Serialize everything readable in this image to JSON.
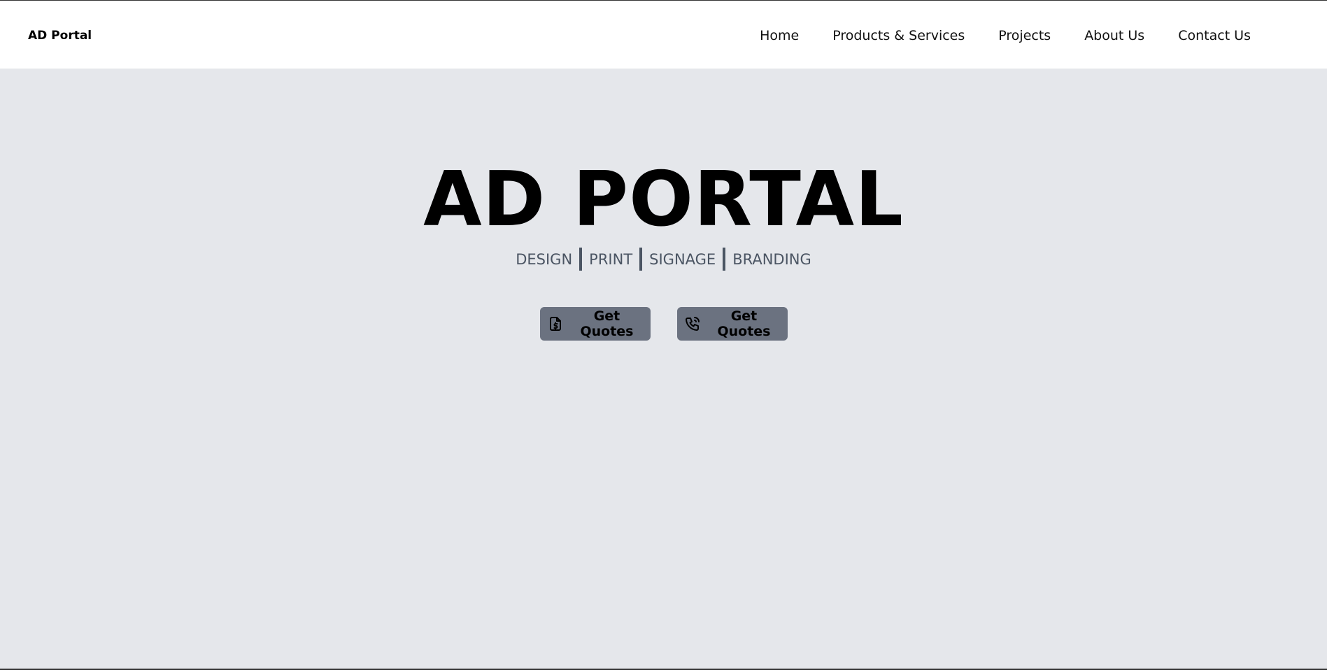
{
  "navbar": {
    "brand": "AD Portal",
    "links": [
      {
        "label": "Home"
      },
      {
        "label": "Products & Services"
      },
      {
        "label": "Projects"
      },
      {
        "label": "About Us"
      },
      {
        "label": "Contact Us"
      }
    ]
  },
  "hero": {
    "title": "AD PORTAL",
    "tagline": [
      "DESIGN",
      "PRINT",
      "SIGNAGE",
      "BRANDING"
    ],
    "buttons": [
      {
        "label": "Get Quotes",
        "icon": "invoice-dollar-icon"
      },
      {
        "label": "Get Quotes",
        "icon": "phone-call-icon"
      }
    ]
  },
  "colors": {
    "background": "#e5e7eb",
    "navbar": "#ffffff",
    "button": "#6b7280",
    "tagline": "#4b5563"
  }
}
